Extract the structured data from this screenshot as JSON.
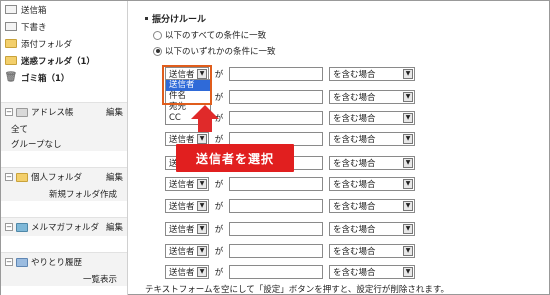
{
  "sidebar": {
    "folders": [
      {
        "icon": "mail-icon",
        "label": "送信箱",
        "bold": false
      },
      {
        "icon": "mail-icon",
        "label": "下書き",
        "bold": false
      },
      {
        "icon": "folder-icon",
        "label": "添付フォルダ",
        "bold": false
      },
      {
        "icon": "folder-icon",
        "label": "迷惑フォルダ（1）",
        "bold": true
      },
      {
        "icon": "trash-icon",
        "label": "ゴミ箱（1）",
        "bold": true
      }
    ],
    "address_book": {
      "title": "アドレス帳",
      "edit": "編集",
      "items": [
        "全て",
        "グループなし"
      ]
    },
    "personal_folders": {
      "title": "個人フォルダ",
      "edit": "編集",
      "items": [
        "新規フォルダ作成"
      ]
    },
    "magazine_folders": {
      "title": "メルマガフォルダ",
      "edit": "編集"
    },
    "history": {
      "title": "やりとり履歴",
      "items": [
        "一覧表示"
      ]
    }
  },
  "main": {
    "title": "振分けルール",
    "radios": [
      {
        "label": "以下のすべての条件に一致",
        "selected": false
      },
      {
        "label": "以下のいずれかの条件に一致",
        "selected": true
      }
    ],
    "rules": [
      {
        "field": "送信者",
        "ga": "が",
        "op": "を含む場合"
      },
      {
        "field": "送信者",
        "ga": "が",
        "op": "を含む場合"
      },
      {
        "field": "送信者",
        "ga": "が",
        "op": "を含む場合"
      },
      {
        "field": "送信者",
        "ga": "が",
        "op": "を含む場合"
      },
      {
        "field": "送信者",
        "ga": "が",
        "op": "を含む場合"
      },
      {
        "field": "送信者",
        "ga": "が",
        "op": "を含む場合"
      },
      {
        "field": "送信者",
        "ga": "が",
        "op": "を含む場合"
      },
      {
        "field": "送信者",
        "ga": "が",
        "op": "を含む場合"
      },
      {
        "field": "送信者",
        "ga": "が",
        "op": "を含む場合"
      },
      {
        "field": "送信者",
        "ga": "が",
        "op": "を含む場合"
      }
    ],
    "dropdown_options": [
      "送信者",
      "件名",
      "宛先",
      "CC"
    ],
    "dropdown_selected": "送信者",
    "callout": "送信者を選択",
    "footer_note": "テキストフォームを空にして「設定」ボタンを押すと、設定行が削除されます。",
    "colors": {
      "callout": "#e11f1f",
      "highlight": "#2f6ad8",
      "outline": "#e05d1c"
    }
  }
}
